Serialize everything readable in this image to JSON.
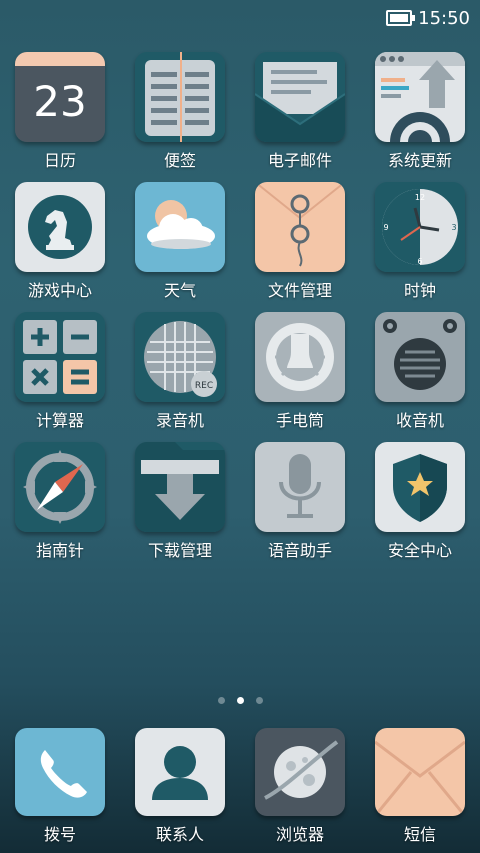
{
  "status_bar": {
    "time": "15:50",
    "battery_icon": "battery-icon"
  },
  "apps": [
    [
      "日历",
      "便签",
      "电子邮件",
      "系统更新"
    ],
    [
      "游戏中心",
      "天气",
      "文件管理",
      "时钟"
    ],
    [
      "计算器",
      "录音机",
      "手电筒",
      "收音机"
    ],
    [
      "指南针",
      "下载管理",
      "语音助手",
      "安全中心"
    ]
  ],
  "calendar_day": "23",
  "recorder_badge": "REC",
  "clock_numbers": {
    "n12": "12",
    "n3": "3",
    "n6": "6",
    "n9": "9"
  },
  "page_indicator": {
    "count": 3,
    "active": 2
  },
  "dock": [
    "拨号",
    "联系人",
    "浏览器",
    "短信"
  ],
  "colors": {
    "accent_teal": "#1d5a66",
    "peach": "#f4c6a8",
    "light_gray": "#dfe3e6",
    "sky_blue": "#6db7d3"
  }
}
